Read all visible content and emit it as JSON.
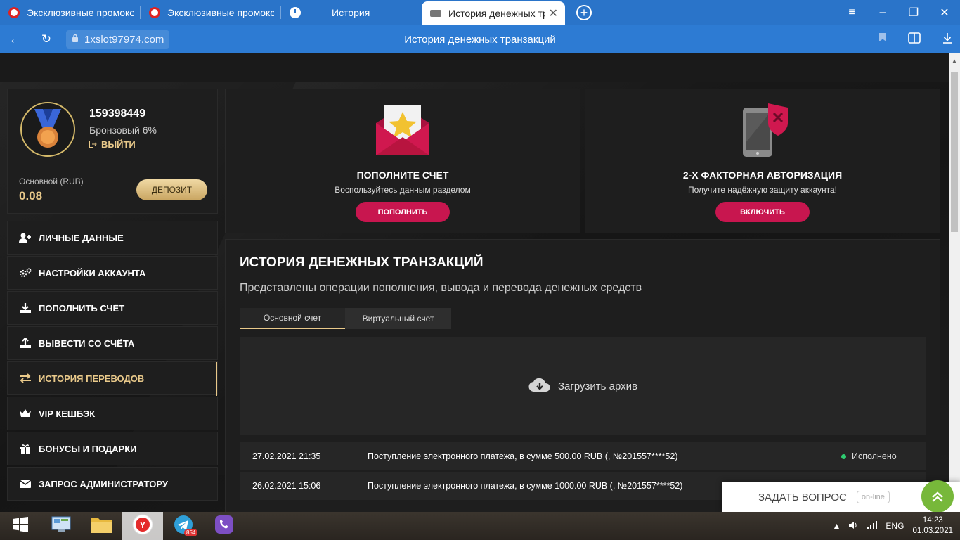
{
  "browser": {
    "tabs": [
      {
        "label": "Эксклюзивные промокод",
        "icon": "promo-favicon",
        "active": false
      },
      {
        "label": "Эксклюзивные промокод",
        "icon": "promo-favicon",
        "active": false
      },
      {
        "label": "История",
        "icon": "history-favicon",
        "active": false
      },
      {
        "label": "История денежных тр",
        "icon": "site-favicon",
        "active": true
      }
    ],
    "tab_close": "✕",
    "new_tab": "+",
    "url": "1xslot97974.com",
    "page_title": "История денежных транзакций"
  },
  "profile": {
    "user_id": "159398449",
    "level": "Бронзовый 6%",
    "logout": "ВЫЙТИ",
    "balance_label": "Основной (RUB)",
    "balance_value": "0.08",
    "deposit_button": "ДЕПОЗИТ"
  },
  "menu": [
    {
      "label": "ЛИЧНЫЕ ДАННЫЕ",
      "icon": "user-add-icon",
      "active": false
    },
    {
      "label": "НАСТРОЙКИ АККАУНТА",
      "icon": "gears-icon",
      "active": false
    },
    {
      "label": "ПОПОЛНИТЬ СЧЁТ",
      "icon": "download-icon",
      "active": false
    },
    {
      "label": "ВЫВЕСТИ СО СЧЁТА",
      "icon": "upload-icon",
      "active": false
    },
    {
      "label": "ИСТОРИЯ ПЕРЕВОДОВ",
      "icon": "transfer-arrows-icon",
      "active": true
    },
    {
      "label": "VIP КЕШБЭК",
      "icon": "crown-icon",
      "active": false
    },
    {
      "label": "БОНУСЫ И ПОДАРКИ",
      "icon": "gift-icon",
      "active": false
    },
    {
      "label": "ЗАПРОС АДМИНИСТРАТОРУ",
      "icon": "envelope-icon",
      "active": false
    }
  ],
  "promos": [
    {
      "title": "ПОПОЛНИТЕ СЧЕТ",
      "subtitle": "Воспользуйтесь данным разделом",
      "button": "ПОПОЛНИТЬ",
      "icon": "envelope-star-icon"
    },
    {
      "title": "2-Х ФАКТОРНАЯ АВТОРИЗАЦИЯ",
      "subtitle": "Получите надёжную защиту аккаунта!",
      "button": "ВКЛЮЧИТЬ",
      "icon": "phone-shield-icon"
    }
  ],
  "history": {
    "title": "ИСТОРИЯ ДЕНЕЖНЫХ ТРАНЗАКЦИЙ",
    "subtitle": "Представлены операции пополнения, вывода и перевода денежных средств",
    "tabs": [
      "Основной счет",
      "Виртуальный счет"
    ],
    "archive_label": "Загрузить архив",
    "rows": [
      {
        "date": "27.02.2021 21:35",
        "description": "Поступление электронного платежа, в сумме 500.00 RUB (, №201557****52)",
        "status": "Исполнено"
      },
      {
        "date": "26.02.2021 15:06",
        "description": "Поступление электронного платежа, в сумме 1000.00 RUB (, №201557****52)",
        "status": ""
      }
    ]
  },
  "chat": {
    "label": "ЗАДАТЬ ВОПРОС",
    "badge": "on-line"
  },
  "taskbar": {
    "telegram_badge": "854",
    "language": "ENG",
    "time": "14:23",
    "date": "01.03.2021"
  },
  "colors": {
    "accent_gold": "#e9c98a",
    "accent_crimson": "#c8164f",
    "browser_blue": "#2a74c9",
    "status_green": "#2ecc71"
  }
}
